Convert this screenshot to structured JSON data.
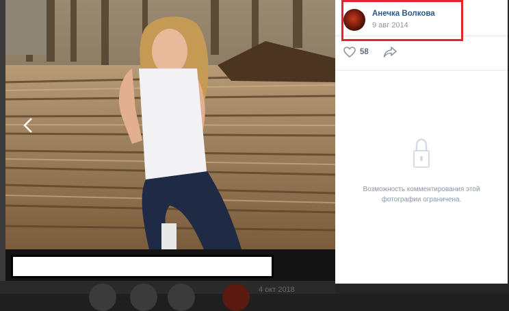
{
  "author": {
    "name": "Анечка Волкова",
    "date": "9 авг 2014"
  },
  "actions": {
    "likes": "58",
    "like_icon": "heart-icon",
    "share_icon": "share-arrow-icon"
  },
  "comments": {
    "restricted_text": "Возможность комментирования этой фотографии ограничена.",
    "icon": "lock-icon"
  },
  "background": {
    "date_partial": "4 окт 2018"
  },
  "colors": {
    "link": "#2a5885",
    "highlight": "#e8212c",
    "muted": "#939393"
  }
}
